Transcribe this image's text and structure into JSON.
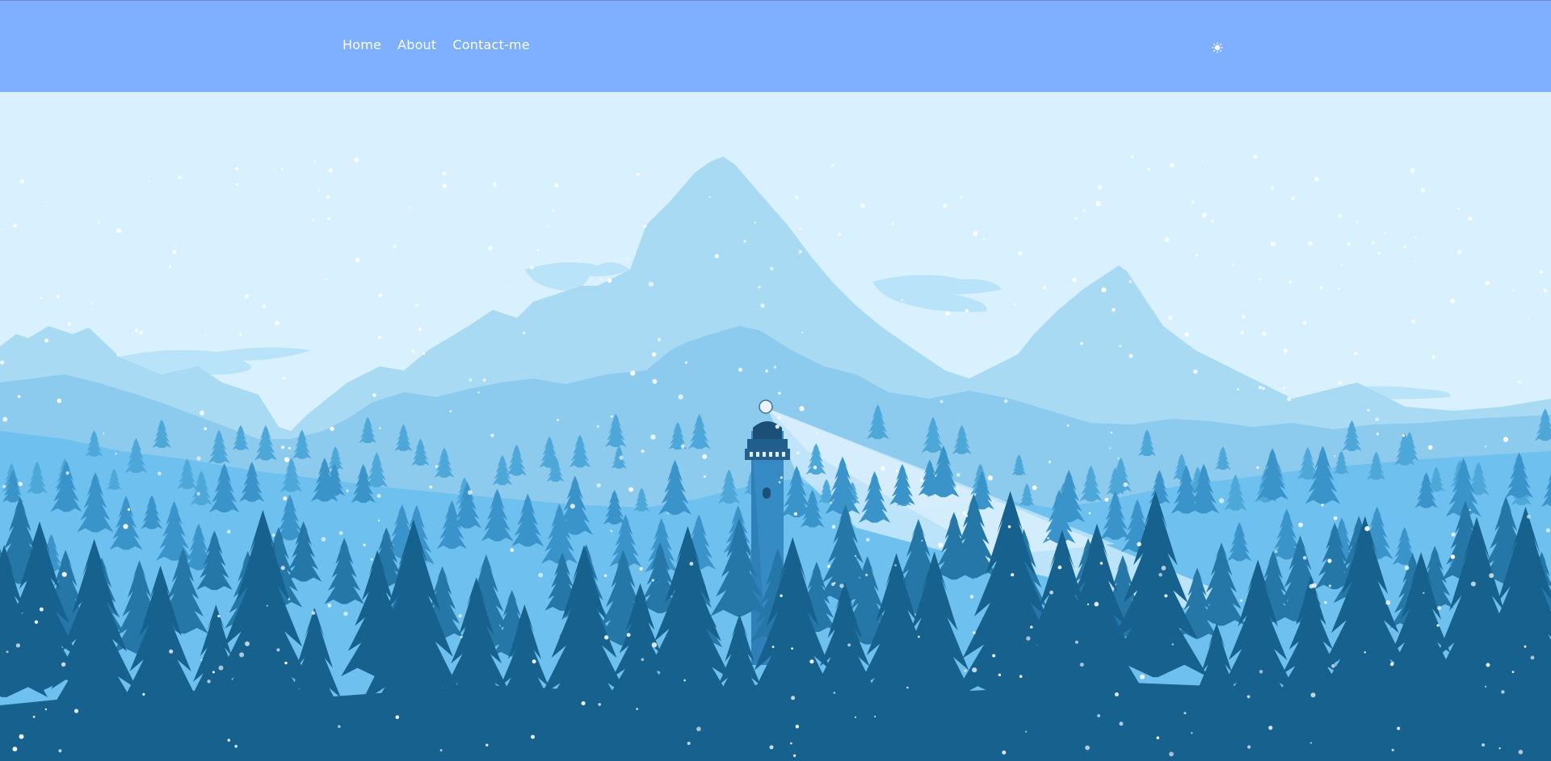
{
  "nav": {
    "links": [
      "Home",
      "About",
      "Contact-me"
    ]
  },
  "icons": {
    "theme_toggle": "sun-icon",
    "scene": "lighthouse-mountain-forest-illustration"
  },
  "colors": {
    "navbar": "#7eb0ff",
    "sky": "#d9f1ff",
    "far_mountains": "#a8daf4",
    "mid_mountains": "#8ccbee",
    "near_hills": "#6ec0ee",
    "forest_mid": "#3b94c9",
    "forest_dark": "#2577a8",
    "forest_front": "#17618e",
    "lighthouse": "#2f7fb8",
    "snow": "#ffffff"
  }
}
